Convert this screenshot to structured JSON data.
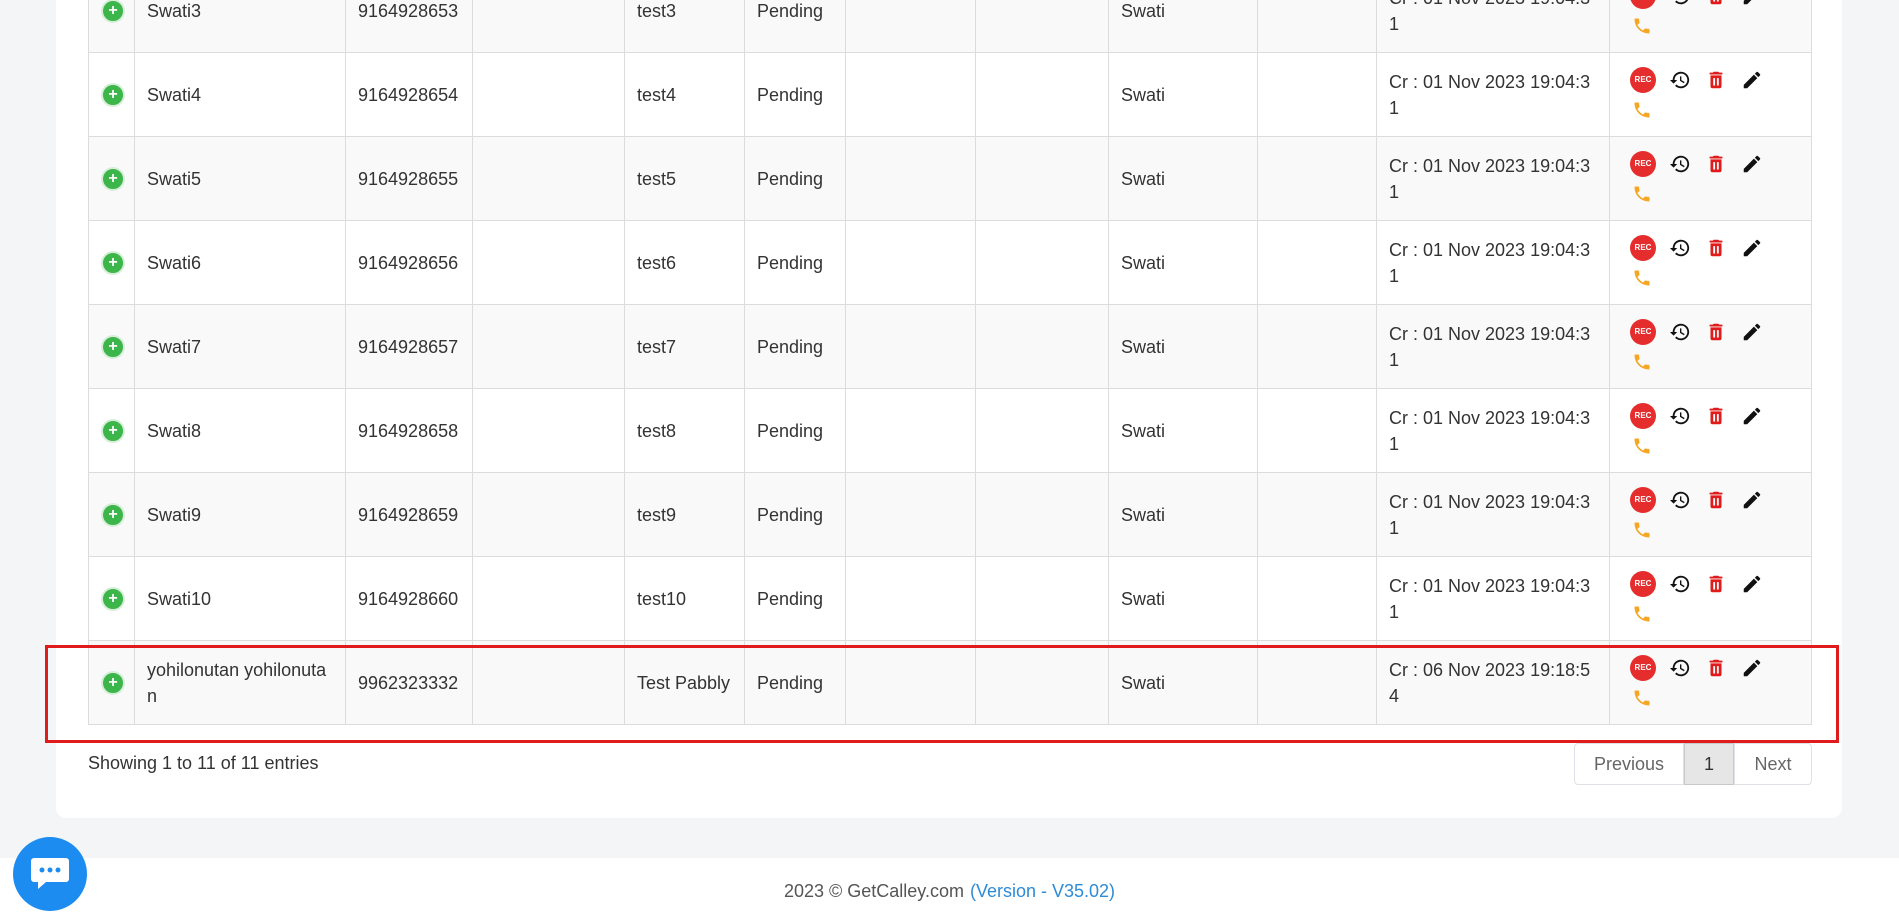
{
  "table": {
    "rows": [
      {
        "name": "Swati3",
        "phone": "9164928653",
        "col4": "",
        "note": "test3",
        "status": "Pending",
        "col7": "",
        "col8": "",
        "agent": "Swati",
        "col10": "",
        "created": "Cr : 01 Nov 2023 19:04:31"
      },
      {
        "name": "Swati4",
        "phone": "9164928654",
        "col4": "",
        "note": "test4",
        "status": "Pending",
        "col7": "",
        "col8": "",
        "agent": "Swati",
        "col10": "",
        "created": "Cr : 01 Nov 2023 19:04:31"
      },
      {
        "name": "Swati5",
        "phone": "9164928655",
        "col4": "",
        "note": "test5",
        "status": "Pending",
        "col7": "",
        "col8": "",
        "agent": "Swati",
        "col10": "",
        "created": "Cr : 01 Nov 2023 19:04:31"
      },
      {
        "name": "Swati6",
        "phone": "9164928656",
        "col4": "",
        "note": "test6",
        "status": "Pending",
        "col7": "",
        "col8": "",
        "agent": "Swati",
        "col10": "",
        "created": "Cr : 01 Nov 2023 19:04:31"
      },
      {
        "name": "Swati7",
        "phone": "9164928657",
        "col4": "",
        "note": "test7",
        "status": "Pending",
        "col7": "",
        "col8": "",
        "agent": "Swati",
        "col10": "",
        "created": "Cr : 01 Nov 2023 19:04:31"
      },
      {
        "name": "Swati8",
        "phone": "9164928658",
        "col4": "",
        "note": "test8",
        "status": "Pending",
        "col7": "",
        "col8": "",
        "agent": "Swati",
        "col10": "",
        "created": "Cr : 01 Nov 2023 19:04:31"
      },
      {
        "name": "Swati9",
        "phone": "9164928659",
        "col4": "",
        "note": "test9",
        "status": "Pending",
        "col7": "",
        "col8": "",
        "agent": "Swati",
        "col10": "",
        "created": "Cr : 01 Nov 2023 19:04:31"
      },
      {
        "name": "Swati10",
        "phone": "9164928660",
        "col4": "",
        "note": "test10",
        "status": "Pending",
        "col7": "",
        "col8": "",
        "agent": "Swati",
        "col10": "",
        "created": "Cr : 01 Nov 2023 19:04:31"
      },
      {
        "name": "yohilonutan yohilonutan",
        "phone": "9962323332",
        "col4": "",
        "note": "Test Pabbly",
        "status": "Pending",
        "col7": "",
        "col8": "",
        "agent": "Swati",
        "col10": "",
        "created": "Cr : 06 Nov 2023 19:18:54"
      }
    ],
    "row_icons": {
      "expand": "plus-circle-icon",
      "rec_label": "REC",
      "history": "history-icon",
      "delete": "trash-icon",
      "edit": "pencil-icon",
      "call": "phone-icon"
    },
    "highlighted_row_index": 8
  },
  "info_text": "Showing 1 to 11 of 11 entries",
  "pagination": {
    "previous": "Previous",
    "current": "1",
    "next": "Next"
  },
  "footer": {
    "copyright": "2023 © GetCalley.com",
    "version": "(Version - V35.02)"
  },
  "chat": {
    "icon": "chat-bubble-icon"
  },
  "colors": {
    "rec": "#e52d2d",
    "delete": "#e01b1b",
    "call": "#f5a623",
    "expand": "#3cb54a",
    "highlight": "#e01b1b",
    "link": "#2d8bd6"
  }
}
